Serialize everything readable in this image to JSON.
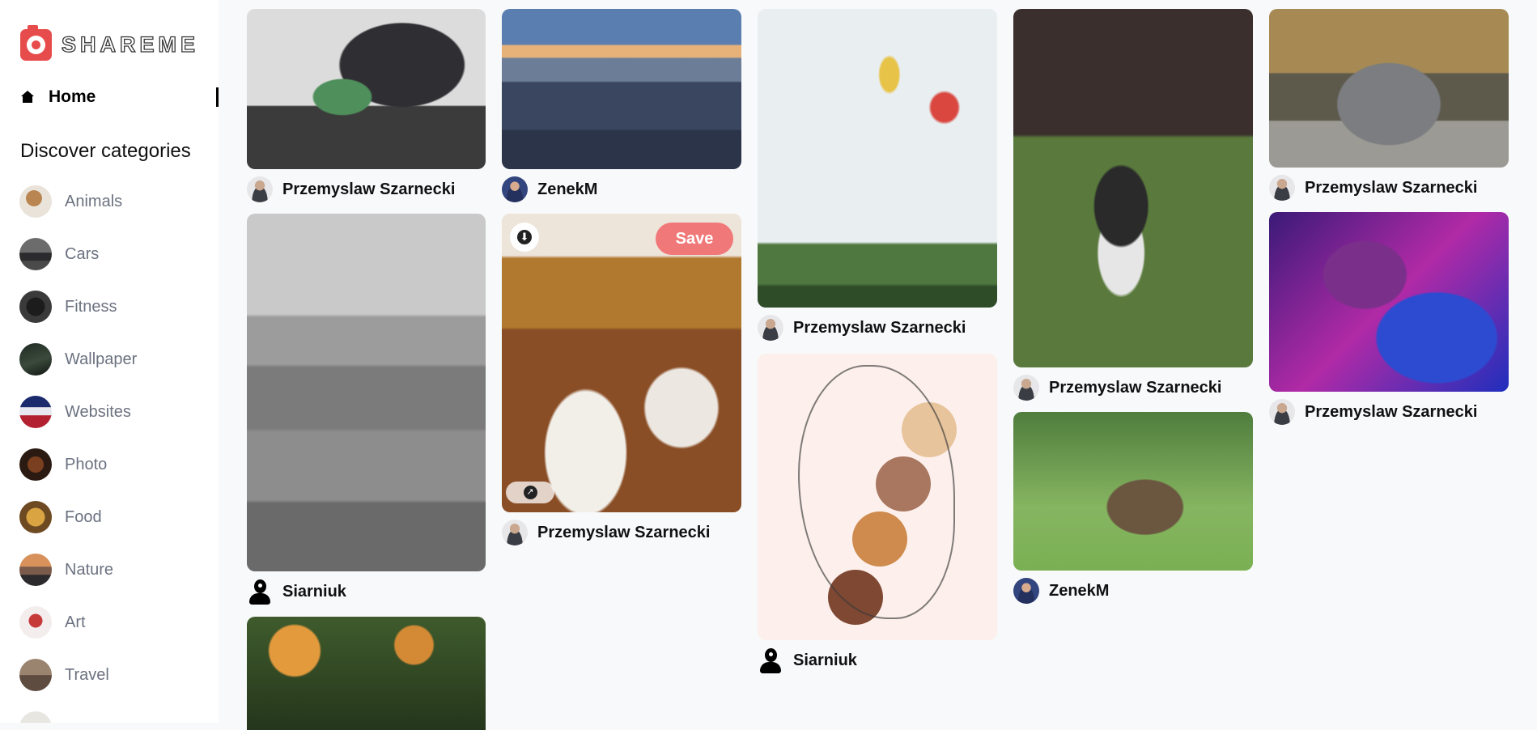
{
  "app": {
    "logo_text": "SHAREME"
  },
  "nav": {
    "home_label": "Home"
  },
  "sidebar": {
    "discover_heading": "Discover categories",
    "categories": [
      {
        "label": "Animals"
      },
      {
        "label": "Cars"
      },
      {
        "label": "Fitness"
      },
      {
        "label": "Wallpaper"
      },
      {
        "label": "Websites"
      },
      {
        "label": "Photo"
      },
      {
        "label": "Food"
      },
      {
        "label": "Nature"
      },
      {
        "label": "Art"
      },
      {
        "label": "Travel"
      }
    ]
  },
  "pins": {
    "hacker": {
      "author": "Przemyslaw Szarnecki",
      "image": "hooded person typing on laptop"
    },
    "city": {
      "author": "ZenekM",
      "image": "city skyline at dusk"
    },
    "gondola": {
      "author": "Przemyslaw Szarnecki",
      "image": "cable car gondolas"
    },
    "husky": {
      "author": "Przemyslaw Szarnecki",
      "image": "husky puppy on grass"
    },
    "car": {
      "author": "Przemyslaw Szarnecki",
      "image": "grey car parked in park"
    },
    "kids": {
      "author": "Siarniuk",
      "image": "two children sitting on stairs"
    },
    "dessert": {
      "author": "Przemyslaw Szarnecki",
      "save_label": "Save",
      "image": "dessert plates on table"
    },
    "art": {
      "author": "Siarniuk",
      "image": "line art woman with circles"
    },
    "hedgehog": {
      "author": "ZenekM",
      "image": "hedgehog in grass"
    },
    "gaming": {
      "author": "Przemyslaw Szarnecki",
      "image": "gaming keyboard and headset neon"
    },
    "flowers": {
      "image": "orange flowers"
    }
  },
  "colors": {
    "accent": "#e74c4c",
    "save_button": "#f07878"
  }
}
